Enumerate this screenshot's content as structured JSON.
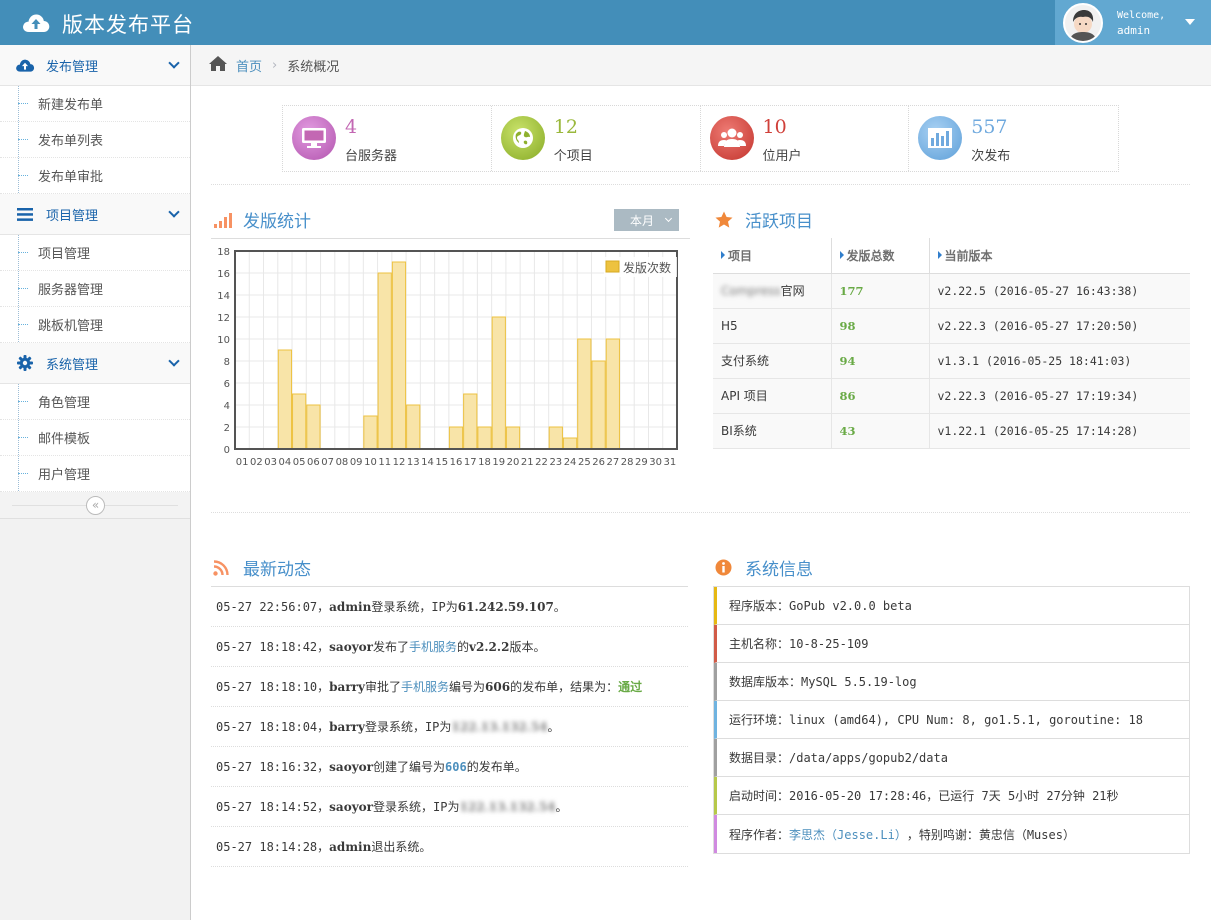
{
  "header": {
    "title": "版本发布平台",
    "welcome": "Welcome,",
    "username": "admin",
    "logo_icon": "cloud-upload-icon",
    "bg_color": "#438eb9"
  },
  "sidebar": {
    "groups": [
      {
        "label": "发布管理",
        "icon": "cloud-upload-icon",
        "items": [
          "新建发布单",
          "发布单列表",
          "发布单审批"
        ]
      },
      {
        "label": "项目管理",
        "icon": "list-icon",
        "items": [
          "项目管理",
          "服务器管理",
          "跳板机管理"
        ]
      },
      {
        "label": "系统管理",
        "icon": "gear-icon",
        "items": [
          "角色管理",
          "邮件模板",
          "用户管理"
        ]
      }
    ],
    "collapse_glyph": "«"
  },
  "breadcrumb": {
    "home": "首页",
    "separator": "›",
    "current": "系统概况"
  },
  "stats": [
    {
      "value": "4",
      "label": "台服务器",
      "color": "#c367b3",
      "icon": "monitor-icon"
    },
    {
      "value": "12",
      "label": "个项目",
      "color": "#9ab83c",
      "icon": "globe-icon"
    },
    {
      "value": "10",
      "label": "位用户",
      "color": "#d0403a",
      "icon": "users-icon"
    },
    {
      "value": "557",
      "label": "次发布",
      "color": "#6fa9de",
      "icon": "bar-chart-icon"
    }
  ],
  "release_stats": {
    "title": "发版统计",
    "period_button": "本月"
  },
  "chart_data": {
    "type": "bar",
    "categories": [
      "01",
      "02",
      "03",
      "04",
      "05",
      "06",
      "07",
      "08",
      "09",
      "10",
      "11",
      "12",
      "13",
      "14",
      "15",
      "16",
      "17",
      "18",
      "19",
      "20",
      "21",
      "22",
      "23",
      "24",
      "25",
      "26",
      "27",
      "28",
      "29",
      "30",
      "31"
    ],
    "series": [
      {
        "name": "发版次数",
        "values": [
          0,
          0,
          0,
          9,
          5,
          4,
          0,
          0,
          0,
          3,
          16,
          17,
          4,
          0,
          0,
          2,
          5,
          2,
          12,
          2,
          0,
          0,
          2,
          1,
          10,
          8,
          10,
          0,
          0,
          0,
          0
        ]
      }
    ],
    "ylim": [
      0,
      18
    ],
    "yticks": [
      0,
      2,
      4,
      6,
      8,
      10,
      12,
      14,
      16,
      18
    ],
    "grid": true,
    "legend": "top-right",
    "bar_color": "#f8e4a8",
    "bar_border": "#edc240"
  },
  "active_projects": {
    "title": "活跃项目",
    "columns": [
      "项目",
      "发版总数",
      "当前版本"
    ],
    "rows": [
      {
        "name_blurred": "Compress",
        "name": "官网",
        "count": "177",
        "version": "v2.22.5 (2016-05-27 16:43:38)"
      },
      {
        "name_blurred": "",
        "name": "H5",
        "count": "98",
        "version": "v2.22.3 (2016-05-27 17:20:50)"
      },
      {
        "name_blurred": "",
        "name": "支付系统",
        "count": "94",
        "version": "v1.3.1 (2016-05-25 18:41:03)"
      },
      {
        "name_blurred": "",
        "name": "API 项目",
        "count": "86",
        "version": "v2.22.3 (2016-05-27 17:19:34)"
      },
      {
        "name_blurred": "",
        "name": "BI系统",
        "count": "43",
        "version": "v1.22.1 (2016-05-25 17:14:28)"
      }
    ]
  },
  "activity": {
    "title": "最新动态",
    "rows": [
      {
        "time": "05-27 22:56:07，",
        "user": "admin",
        "t1": " 登录系统，IP为 ",
        "ip": "61.242.59.107",
        "t2": "。"
      },
      {
        "time": "05-27 18:18:42，",
        "user": "saoyor",
        "t1": " 发布了 ",
        "link": "手机服务",
        "t2": " 的 ",
        "ver": "v2.2.2",
        "t3": " 版本。"
      },
      {
        "time": "05-27 18:18:10，",
        "user": "barry",
        "t1": " 审批了 ",
        "link": "手机服务",
        "t2": " 编号为",
        "num": "606",
        "t3": "的发布单，结果为：",
        "result": "通过"
      },
      {
        "time": "05-27 18:18:04，",
        "user": "barry",
        "t1": " 登录系统，IP为 ",
        "ip_blur": "122.13.132.54",
        "t2": "。"
      },
      {
        "time": "05-27 18:16:32，",
        "user": "saoyor",
        "t1": " 创建了编号为 ",
        "num": "606",
        "t2": " 的发布单。"
      },
      {
        "time": "05-27 18:14:52，",
        "user": "saoyor",
        "t1": " 登录系统，IP为 ",
        "ip_blur": "122.13.132.54",
        "t2": "。"
      },
      {
        "time": "05-27 18:14:28，",
        "user": "admin",
        "t1": " 退出系统。"
      }
    ]
  },
  "system_info": {
    "title": "系统信息",
    "rows": [
      {
        "text": "程序版本：GoPub v2.0.0 beta",
        "color": "#e6b813"
      },
      {
        "text": "主机名称：10-8-25-109",
        "color": "#d15b47"
      },
      {
        "text": "数据库版本：MySQL 5.5.19-log",
        "color": "#a0a0a0"
      },
      {
        "text": "运行环境：linux (amd64), CPU Num: 8, go1.5.1, goroutine: 18",
        "color": "#6fb3e0"
      },
      {
        "text": "数据目录：/data/apps/gopub2/data",
        "color": "#a0a0a0"
      },
      {
        "text": "启动时间：2016-05-20 17:28:46，已运行 7天 5小时 27分钟 21秒",
        "color": "#b6c84a"
      },
      {
        "author_prefix": "程序作者：",
        "author": "李思杰（Jesse.Li）",
        "author_suffix": "，特别鸣谢：黄忠信（Muses）",
        "color": "#d08ae0"
      }
    ]
  }
}
